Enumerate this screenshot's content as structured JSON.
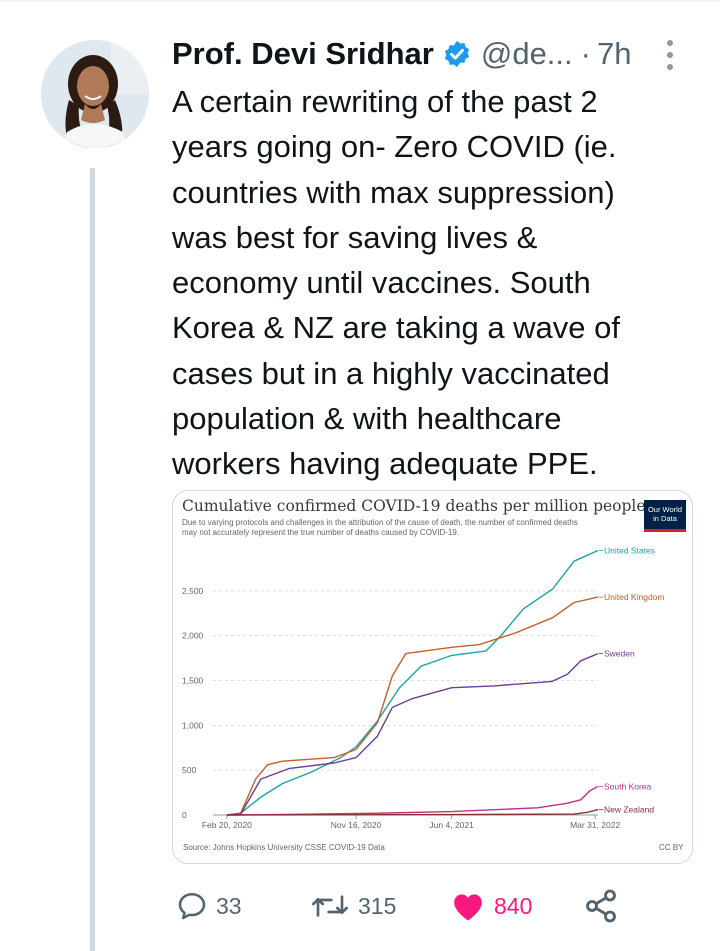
{
  "tweet": {
    "author_name": "Prof. Devi Sridhar",
    "handle": "@de...",
    "separator": "·",
    "time_ago": "7h",
    "text_lines": [
      "A certain rewriting of the past 2",
      "years going on- Zero COVID (ie.",
      "countries with max suppression)",
      "was best for saving lives &",
      "economy until vaccines. South",
      "Korea & NZ are taking a wave of",
      "cases but in a highly vaccinated",
      "population & with healthcare",
      "workers having adequate PPE."
    ],
    "verified_color": "#1d9bf0",
    "like_color": "#f91880"
  },
  "actions": {
    "replies": "33",
    "retweets": "315",
    "likes": "840"
  },
  "icons": {
    "reply": "speech-bubble-icon",
    "retweet": "retweet-arrows-icon",
    "like": "heart-icon",
    "share": "share-icon",
    "more": "vertical-dots-icon"
  },
  "chart_data": {
    "type": "line",
    "title": "Cumulative confirmed COVID-19 deaths per million people",
    "subtitle_lines": [
      "Due to varying protocols and challenges in the attribution of the cause of death, the number of confirmed deaths",
      "may not accurately represent the true number of deaths caused by COVID-19."
    ],
    "logo_lines": [
      "Our World",
      "in Data"
    ],
    "source": "Source: Johns Hopkins University CSSE COVID-19 Data",
    "license": "CC BY",
    "x_tick_labels": [
      "Feb 20, 2020",
      "Nov 16, 2020",
      "Jun 4, 2021",
      "Mar 31, 2022"
    ],
    "x_tick_values": [
      "2020-02-20",
      "2020-11-16",
      "2021-06-04",
      "2022-03-31"
    ],
    "xlim": [
      "2020-01-22",
      "2022-04-06"
    ],
    "y_tick_labels": [
      "0",
      "500",
      "1,000",
      "1,500",
      "2,000",
      "2,500"
    ],
    "y_tick_values": [
      0,
      500,
      1000,
      1500,
      2000,
      2500
    ],
    "ylim": [
      0,
      3000
    ],
    "grid": "horizontal-dashed",
    "legend": "end-of-line labels",
    "series": [
      {
        "name": "United States",
        "color": "#18a6a6",
        "points": [
          [
            "2020-02-20",
            0
          ],
          [
            "2020-03-20",
            20
          ],
          [
            "2020-05-01",
            200
          ],
          [
            "2020-06-15",
            350
          ],
          [
            "2020-08-15",
            480
          ],
          [
            "2020-10-15",
            640
          ],
          [
            "2020-11-16",
            760
          ],
          [
            "2020-12-31",
            1050
          ],
          [
            "2021-02-15",
            1420
          ],
          [
            "2021-04-01",
            1660
          ],
          [
            "2021-06-04",
            1780
          ],
          [
            "2021-08-15",
            1830
          ],
          [
            "2021-09-15",
            2000
          ],
          [
            "2021-11-01",
            2300
          ],
          [
            "2022-01-01",
            2520
          ],
          [
            "2022-02-15",
            2830
          ],
          [
            "2022-04-06",
            2950
          ]
        ]
      },
      {
        "name": "United Kingdom",
        "color": "#c0612b",
        "points": [
          [
            "2020-02-20",
            0
          ],
          [
            "2020-03-20",
            20
          ],
          [
            "2020-04-20",
            400
          ],
          [
            "2020-05-15",
            560
          ],
          [
            "2020-06-15",
            600
          ],
          [
            "2020-10-01",
            640
          ],
          [
            "2020-11-16",
            730
          ],
          [
            "2020-12-31",
            1030
          ],
          [
            "2021-01-31",
            1550
          ],
          [
            "2021-02-28",
            1800
          ],
          [
            "2021-06-04",
            1870
          ],
          [
            "2021-08-01",
            1900
          ],
          [
            "2021-10-15",
            2030
          ],
          [
            "2022-01-01",
            2200
          ],
          [
            "2022-02-15",
            2370
          ],
          [
            "2022-04-06",
            2430
          ]
        ]
      },
      {
        "name": "Sweden",
        "color": "#6d3e91",
        "points": [
          [
            "2020-02-20",
            0
          ],
          [
            "2020-03-20",
            10
          ],
          [
            "2020-05-01",
            400
          ],
          [
            "2020-06-30",
            520
          ],
          [
            "2020-10-01",
            580
          ],
          [
            "2020-11-16",
            640
          ],
          [
            "2020-12-31",
            880
          ],
          [
            "2021-01-31",
            1200
          ],
          [
            "2021-03-15",
            1300
          ],
          [
            "2021-06-04",
            1420
          ],
          [
            "2021-09-01",
            1440
          ],
          [
            "2021-12-31",
            1490
          ],
          [
            "2022-02-01",
            1570
          ],
          [
            "2022-03-01",
            1720
          ],
          [
            "2022-04-06",
            1800
          ]
        ]
      },
      {
        "name": "South Korea",
        "color": "#c12f8c",
        "points": [
          [
            "2020-02-20",
            0
          ],
          [
            "2020-06-01",
            4
          ],
          [
            "2021-01-01",
            20
          ],
          [
            "2021-06-04",
            38
          ],
          [
            "2021-12-01",
            80
          ],
          [
            "2022-01-31",
            130
          ],
          [
            "2022-03-01",
            170
          ],
          [
            "2022-03-20",
            270
          ],
          [
            "2022-04-06",
            320
          ]
        ]
      },
      {
        "name": "New Zealand",
        "color": "#883039",
        "points": [
          [
            "2020-02-20",
            0
          ],
          [
            "2021-06-04",
            5
          ],
          [
            "2022-02-15",
            10
          ],
          [
            "2022-03-15",
            30
          ],
          [
            "2022-04-06",
            60
          ]
        ]
      }
    ]
  }
}
